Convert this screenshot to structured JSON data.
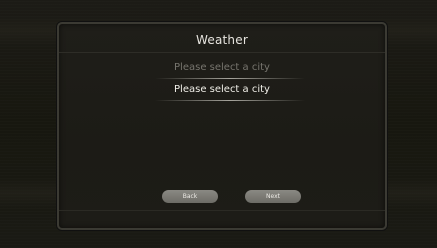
{
  "dialog": {
    "title": "Weather",
    "city_options": {
      "ghost": "Please select a city",
      "selected": "Please select a city"
    },
    "buttons": {
      "back_label": "Back",
      "next_label": "Next"
    }
  }
}
